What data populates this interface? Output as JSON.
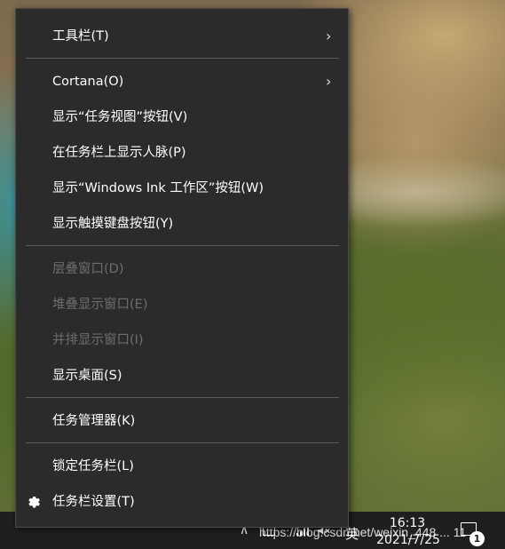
{
  "menu": {
    "items": [
      {
        "label": "工具栏(T)",
        "submenu": true,
        "disabled": false
      },
      {
        "label": "Cortana(O)",
        "submenu": true,
        "disabled": false
      },
      {
        "label": "显示“任务视图”按钮(V)",
        "submenu": false,
        "disabled": false
      },
      {
        "label": "在任务栏上显示人脉(P)",
        "submenu": false,
        "disabled": false
      },
      {
        "label": "显示“Windows Ink 工作区”按钮(W)",
        "submenu": false,
        "disabled": false
      },
      {
        "label": "显示触摸键盘按钮(Y)",
        "submenu": false,
        "disabled": false
      },
      {
        "label": "层叠窗口(D)",
        "submenu": false,
        "disabled": true
      },
      {
        "label": "堆叠显示窗口(E)",
        "submenu": false,
        "disabled": true
      },
      {
        "label": "并排显示窗口(I)",
        "submenu": false,
        "disabled": true
      },
      {
        "label": "显示桌面(S)",
        "submenu": false,
        "disabled": false
      },
      {
        "label": "任务管理器(K)",
        "submenu": false,
        "disabled": false
      },
      {
        "label": "锁定任务栏(L)",
        "submenu": false,
        "disabled": false
      },
      {
        "label": "任务栏设置(T)",
        "submenu": false,
        "disabled": false,
        "icon": "gear-icon"
      }
    ]
  },
  "taskbar": {
    "ime": "英",
    "time": "16:13",
    "date": "2021/7/25",
    "notification_count": "1"
  },
  "watermark": "https://blog.csdn.net/weixin_448 ... 11"
}
